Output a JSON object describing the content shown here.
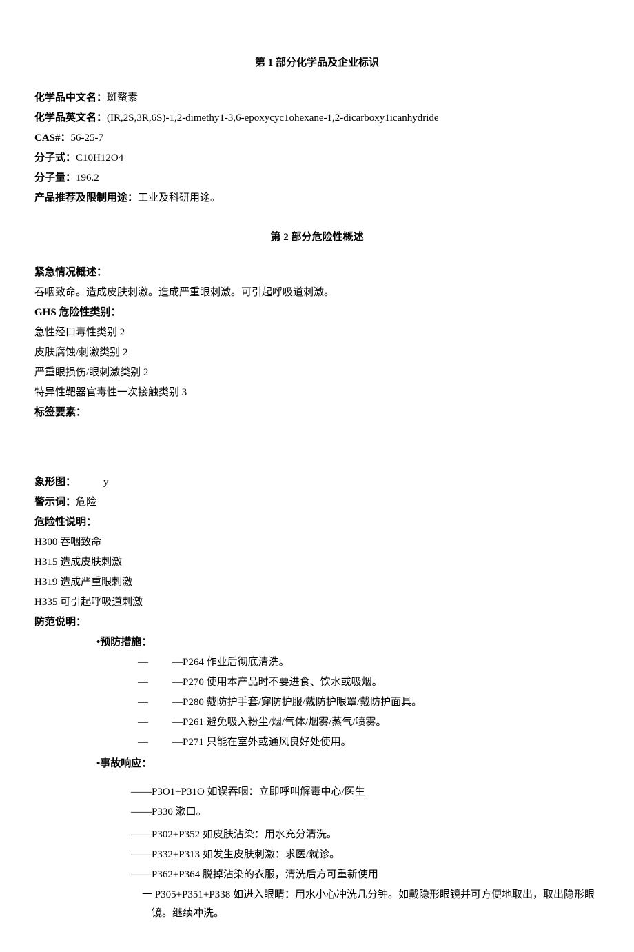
{
  "section1": {
    "heading": "第 1 部分化学品及企业标识",
    "fields": {
      "cn_label": "化学品中文名：",
      "cn_value": "斑蝥素",
      "en_label": "化学品英文名：",
      "en_value": "(IR,2S,3R,6S)-1,2-dimethy1-3,6-epoxycyc1ohexane-1,2-dicarboxy1icanhydride",
      "cas_label": "CAS#：",
      "cas_value": "56-25-7",
      "formula_label": "分子式：",
      "formula_value": "C10H12O4",
      "mw_label": "分子量：",
      "mw_value": "196.2",
      "use_label": "产品推荐及限制用途：",
      "use_value": "工业及科研用途。"
    }
  },
  "section2": {
    "heading": "第 2 部分危险性概述",
    "emergency_label": "紧急情况概述：",
    "emergency_value": "吞咽致命。造成皮肤刺激。造成严重眼刺激。可引起呼吸道刺激。",
    "ghs_label": "GHS 危险性类别：",
    "ghs_items": [
      "急性经口毒性类别 2",
      "皮肤腐蚀/刺激类别 2",
      "严重眼损伤/眼刺激类别 2",
      "特异性靶器官毒性一次接触类别 3"
    ],
    "label_elements": "标签要素：",
    "pictogram_label": "象形图：",
    "pictogram_value": "y",
    "signal_label": "警示词：",
    "signal_value": "危险",
    "hazard_label": "危险性说明：",
    "hazard_items": [
      "H300 吞咽致命",
      "H315 造成皮肤刺激",
      "H319 造成严重眼刺激",
      "H335 可引起呼吸道刺激"
    ],
    "precaution_label": "防范说明：",
    "prevention_label": "•预防措施：",
    "prevention_items": [
      "—P264 作业后彻底清洗。",
      "—P270 使用本产品时不要进食、饮水或吸烟。",
      "—P280 戴防护手套/穿防护服/戴防护眼罩/戴防护面具。",
      "—P261 避免吸入粉尘/烟/气体/烟雾/蒸气/喷雾。",
      "—P271 只能在室外或通风良好处使用。"
    ],
    "response_label": "•事故响应：",
    "response_items": [
      "——P3O1+P31O 如误吞咽：立即呼叫解毒中心/医生",
      "——P330 漱口。",
      "——P302+P352 如皮肤沾染：用水充分清洗。",
      "——P332+P313 如发生皮肤刺激：求医/就诊。",
      "——P362+P364 脱掉沾染的衣服，清洗后方可重新使用",
      "一 P305+P351+P338 如进入眼睛：用水小心冲洗几分钟。如戴隐形眼镜并可方便地取出，取出隐形眼镜。继续冲洗。"
    ],
    "dash": "—"
  }
}
